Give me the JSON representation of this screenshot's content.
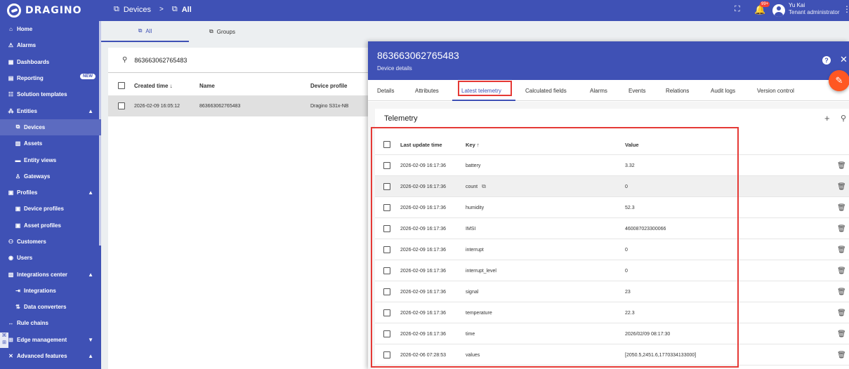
{
  "topbar": {
    "logo_text": "DRAGINO",
    "breadcrumb": [
      {
        "label": "Devices",
        "icon": "devices-icon"
      },
      {
        "label": "All",
        "icon": "devices-group-icon"
      }
    ],
    "breadcrumb_separator": ">",
    "notification_count": "99+",
    "user_name": "Yu Kai",
    "user_role": "Tenant administrator"
  },
  "sidebar": {
    "items": [
      {
        "label": "Home",
        "icon": "home-icon"
      },
      {
        "label": "Alarms",
        "icon": "alarm-icon"
      },
      {
        "label": "Dashboards",
        "icon": "dashboard-icon"
      },
      {
        "label": "Reporting",
        "icon": "report-icon",
        "badge": "NEW"
      },
      {
        "label": "Solution templates",
        "icon": "templates-icon"
      },
      {
        "label": "Entities",
        "icon": "entities-icon",
        "expanded": true
      },
      {
        "label": "Devices",
        "icon": "devices-icon",
        "sub": true,
        "active": true
      },
      {
        "label": "Assets",
        "icon": "assets-icon",
        "sub": true
      },
      {
        "label": "Entity views",
        "icon": "entity-views-icon",
        "sub": true
      },
      {
        "label": "Gateways",
        "icon": "gateways-icon",
        "sub": true
      },
      {
        "label": "Profiles",
        "icon": "profiles-icon",
        "expanded": true
      },
      {
        "label": "Device profiles",
        "icon": "device-profile-icon",
        "sub": true
      },
      {
        "label": "Asset profiles",
        "icon": "asset-profile-icon",
        "sub": true
      },
      {
        "label": "Customers",
        "icon": "customers-icon"
      },
      {
        "label": "Users",
        "icon": "users-icon"
      },
      {
        "label": "Integrations center",
        "icon": "integrations-center-icon",
        "expanded": true
      },
      {
        "label": "Integrations",
        "icon": "integrations-icon",
        "sub": true
      },
      {
        "label": "Data converters",
        "icon": "data-converters-icon",
        "sub": true
      },
      {
        "label": "Rule chains",
        "icon": "rule-chains-icon"
      },
      {
        "label": "Edge management",
        "icon": "edge-icon",
        "collapsed": true
      },
      {
        "label": "Advanced features",
        "icon": "advanced-icon",
        "expanded": true
      }
    ]
  },
  "main": {
    "tabs": [
      {
        "label": "All",
        "active": true
      },
      {
        "label": "Groups",
        "active": false
      }
    ],
    "search_value": "863663062765483",
    "columns": {
      "created": "Created time ↓",
      "name": "Name",
      "profile": "Device profile"
    },
    "rows": [
      {
        "created": "2026-02-09 16:05:12",
        "name": "863663062765483",
        "profile": "Dragino S31x-NB"
      }
    ]
  },
  "drawer": {
    "title": "863663062765483",
    "subtitle": "Device details",
    "tabs": [
      "Details",
      "Attributes",
      "Latest telemetry",
      "Calculated fields",
      "Alarms",
      "Events",
      "Relations",
      "Audit logs",
      "Version control"
    ],
    "active_tab": "Latest telemetry"
  },
  "telemetry": {
    "title": "Telemetry",
    "columns": {
      "time": "Last update time",
      "key": "Key ↑",
      "value": "Value"
    },
    "rows": [
      {
        "time": "2026-02-09 16:17:36",
        "key": "battery",
        "value": "3.32"
      },
      {
        "time": "2026-02-09 16:17:36",
        "key": "count",
        "value": "0"
      },
      {
        "time": "2026-02-09 16:17:36",
        "key": "humidity",
        "value": "52.3"
      },
      {
        "time": "2026-02-09 16:17:36",
        "key": "IMSI",
        "value": "460087023300066"
      },
      {
        "time": "2026-02-09 16:17:36",
        "key": "interrupt",
        "value": "0"
      },
      {
        "time": "2026-02-09 16:17:36",
        "key": "interrupt_level",
        "value": "0"
      },
      {
        "time": "2026-02-09 16:17:36",
        "key": "signal",
        "value": "23"
      },
      {
        "time": "2026-02-09 16:17:36",
        "key": "temperature",
        "value": "22.3"
      },
      {
        "time": "2026-02-09 16:17:36",
        "key": "time",
        "value": "2026/02/09 08:17:30"
      },
      {
        "time": "2026-02-06 07:28:53",
        "key": "values",
        "value": "[2050.5,2451.6,1770334133000]"
      }
    ]
  },
  "colors": {
    "primary": "#3f51b5",
    "accent": "#ff5722",
    "highlight": "#e53935"
  }
}
